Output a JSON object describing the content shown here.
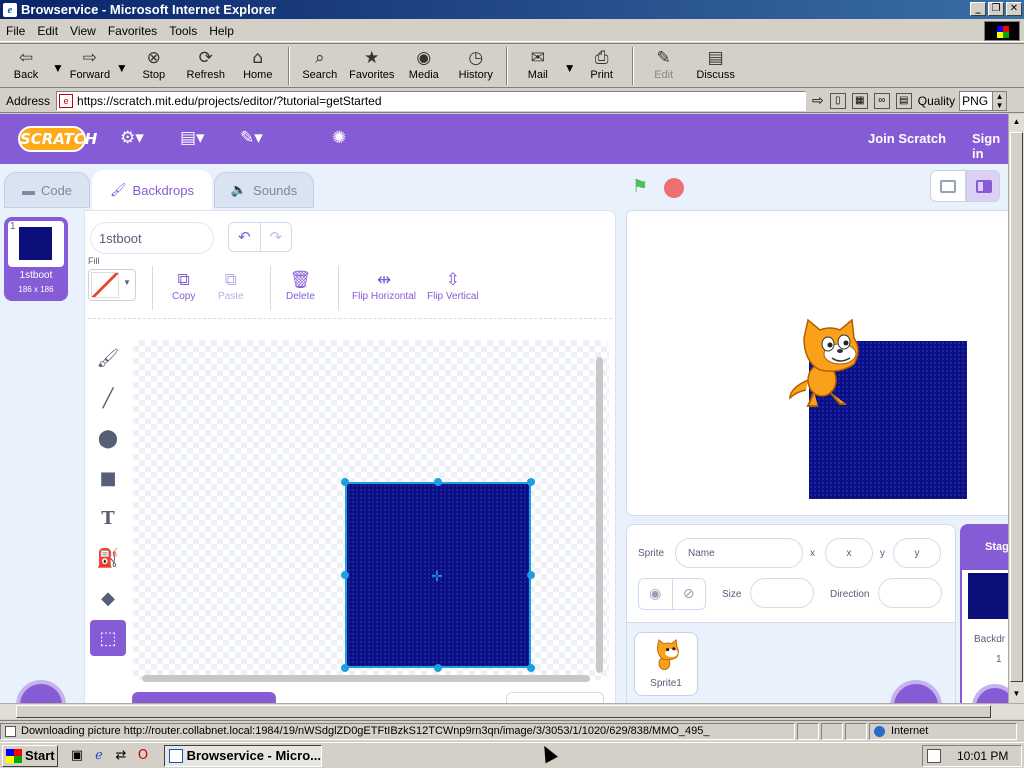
{
  "window": {
    "title": "Browservice - Microsoft Internet Explorer",
    "buttons": [
      "_",
      "❐",
      "✕"
    ]
  },
  "menu": [
    "File",
    "Edit",
    "View",
    "Favorites",
    "Tools",
    "Help"
  ],
  "toolbar": [
    {
      "label": "Back",
      "icon": "back-arrow-icon",
      "glyph": "⇦",
      "enabled": true
    },
    {
      "label": "Forward",
      "icon": "forward-arrow-icon",
      "glyph": "⇨",
      "enabled": true
    },
    {
      "label": "Stop",
      "icon": "stop-icon",
      "glyph": "⊗",
      "enabled": true
    },
    {
      "label": "Refresh",
      "icon": "refresh-icon",
      "glyph": "⟳",
      "enabled": true
    },
    {
      "label": "Home",
      "icon": "home-icon",
      "glyph": "⌂",
      "enabled": true
    },
    {
      "label": "Search",
      "icon": "search-icon",
      "glyph": "⌕",
      "enabled": true
    },
    {
      "label": "Favorites",
      "icon": "favorites-icon",
      "glyph": "★",
      "enabled": true
    },
    {
      "label": "Media",
      "icon": "media-icon",
      "glyph": "◉",
      "enabled": true
    },
    {
      "label": "History",
      "icon": "history-icon",
      "glyph": "◷",
      "enabled": true
    },
    {
      "label": "Mail",
      "icon": "mail-icon",
      "glyph": "✉",
      "enabled": true
    },
    {
      "label": "Print",
      "icon": "print-icon",
      "glyph": "⎙",
      "enabled": true
    },
    {
      "label": "Edit",
      "icon": "edit-icon",
      "glyph": "✎",
      "enabled": false
    },
    {
      "label": "Discuss",
      "icon": "discuss-icon",
      "glyph": "▤",
      "enabled": true
    }
  ],
  "address": {
    "label": "Address",
    "url": "https://scratch.mit.edu/projects/editor/?tutorial=getStarted",
    "quality_label": "Quality",
    "quality_value": "PNG"
  },
  "scratch": {
    "logo": "SCRATCH",
    "join": "Join Scratch",
    "signin": "Sign in",
    "tabs": {
      "code": "Code",
      "backdrops": "Backdrops",
      "sounds": "Sounds"
    },
    "backdrop_list": [
      {
        "index": "1",
        "name": "1stboot",
        "size": "186 x 186"
      }
    ],
    "costume_name": "1stboot",
    "fill_label": "Fill",
    "paint_tools": {
      "copy": "Copy",
      "paste": "Paste",
      "delete": "Delete",
      "flip_h": "Flip Horizontal",
      "flip_v": "Flip Vertical"
    },
    "sprite_info": {
      "sprite_label": "Sprite",
      "name_placeholder": "Name",
      "x_label": "x",
      "x_placeholder": "x",
      "y_label": "y",
      "y_placeholder": "y",
      "size_label": "Size",
      "direction_label": "Direction"
    },
    "sprites": [
      {
        "name": "Sprite1"
      }
    ],
    "stage_pane": {
      "header": "Stag",
      "backdrops_label": "Backdr",
      "count": "1"
    }
  },
  "status": {
    "text": "Downloading picture http://router.collabnet.local:1984/19/nWSdglZD0gETFtIBzkS12TCWnp9rn3qn/image/3/3053/1/1020/629/838/MMO_495_",
    "zone": "Internet"
  },
  "taskbar": {
    "start": "Start",
    "task": "Browservice - Micro...",
    "clock": "10:01 PM"
  }
}
